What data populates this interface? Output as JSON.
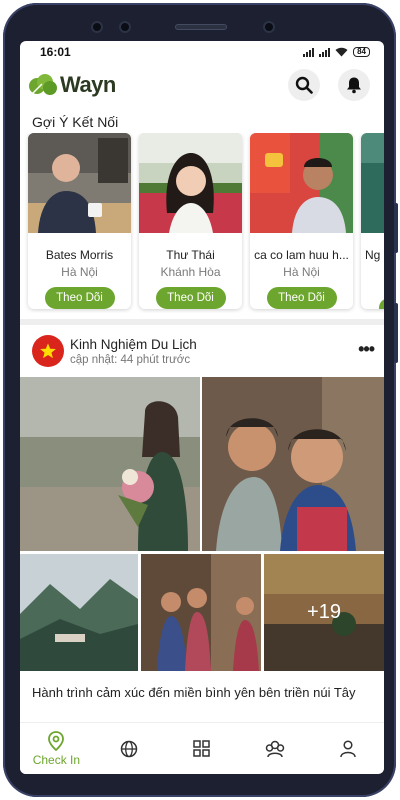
{
  "status_bar": {
    "time": "16:01",
    "battery": "84"
  },
  "header": {
    "app_name": "Wayn",
    "logo_color": "#6da62e"
  },
  "suggestions": {
    "title": "Gợi Ý Kết Nối",
    "follow_color": "#6da62e",
    "cards": [
      {
        "name": "Bates Morris",
        "location": "Hà Nội",
        "follow_label": "Theo Dõi"
      },
      {
        "name": "Thư Thái",
        "location": "Khánh Hòa",
        "follow_label": "Theo Dõi"
      },
      {
        "name": "ca co lam huu h...",
        "location": "Hà Nội",
        "follow_label": "Theo Dõi"
      },
      {
        "name": "Ng",
        "location": "",
        "follow_label": ""
      }
    ]
  },
  "post": {
    "author": "Kinh Nghiệm Du Lịch",
    "updated": "cập nhật: 44 phút trước",
    "more_photos": "+19",
    "caption": "Hành trình cảm xúc đến miền bình yên bên triền núi Tây"
  },
  "bottom_nav": {
    "active_label": "Check In",
    "items": [
      "location-pin",
      "globe",
      "grid",
      "community",
      "profile"
    ]
  }
}
